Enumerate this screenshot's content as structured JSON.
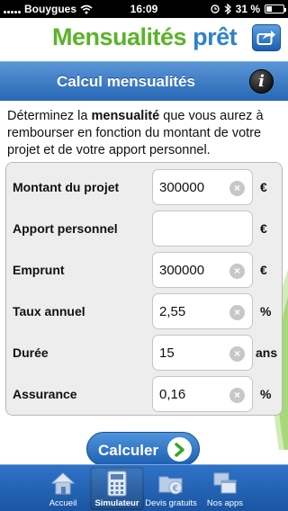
{
  "status_bar": {
    "carrier": "Bouygues",
    "time": "16:09",
    "battery_percent": "31 %",
    "battery_level": 0.31
  },
  "header": {
    "logo_part1": "Mensualités",
    "logo_part2": "prêt",
    "share_icon": "share-arrow-icon"
  },
  "titlebar": {
    "title": "Calcul mensualités",
    "info_label": "i"
  },
  "intro": {
    "before": "Déterminez la ",
    "bold": "mensualité",
    "after": " que vous aurez à rembourser en fonction du montant de votre projet et de votre apport personnel."
  },
  "form": {
    "rows": [
      {
        "label": "Montant du projet",
        "value": "300000",
        "unit": "€",
        "clearable": true
      },
      {
        "label": "Apport personnel",
        "value": "",
        "unit": "€",
        "clearable": false
      },
      {
        "label": "Emprunt",
        "value": "300000",
        "unit": "€",
        "clearable": true
      },
      {
        "label": "Taux annuel",
        "value": "2,55",
        "unit": "%",
        "clearable": true
      },
      {
        "label": "Durée",
        "value": "15",
        "unit": "ans",
        "clearable": true
      },
      {
        "label": "Assurance",
        "value": "0,16",
        "unit": "%",
        "clearable": true
      }
    ]
  },
  "calculate_button": {
    "label": "Calculer"
  },
  "tabbar": {
    "tabs": [
      {
        "label": "Accueil",
        "icon": "home-icon",
        "active": false
      },
      {
        "label": "Simulateur",
        "icon": "calculator-icon",
        "active": true
      },
      {
        "label": "Devis gratuits",
        "icon": "folder-euro-icon",
        "active": false
      },
      {
        "label": "Nos apps",
        "icon": "windows-icon",
        "active": false
      }
    ]
  },
  "colors": {
    "brand_green": "#5bb329",
    "brand_blue": "#2e82c9",
    "bar_blue": "#2767b5"
  }
}
